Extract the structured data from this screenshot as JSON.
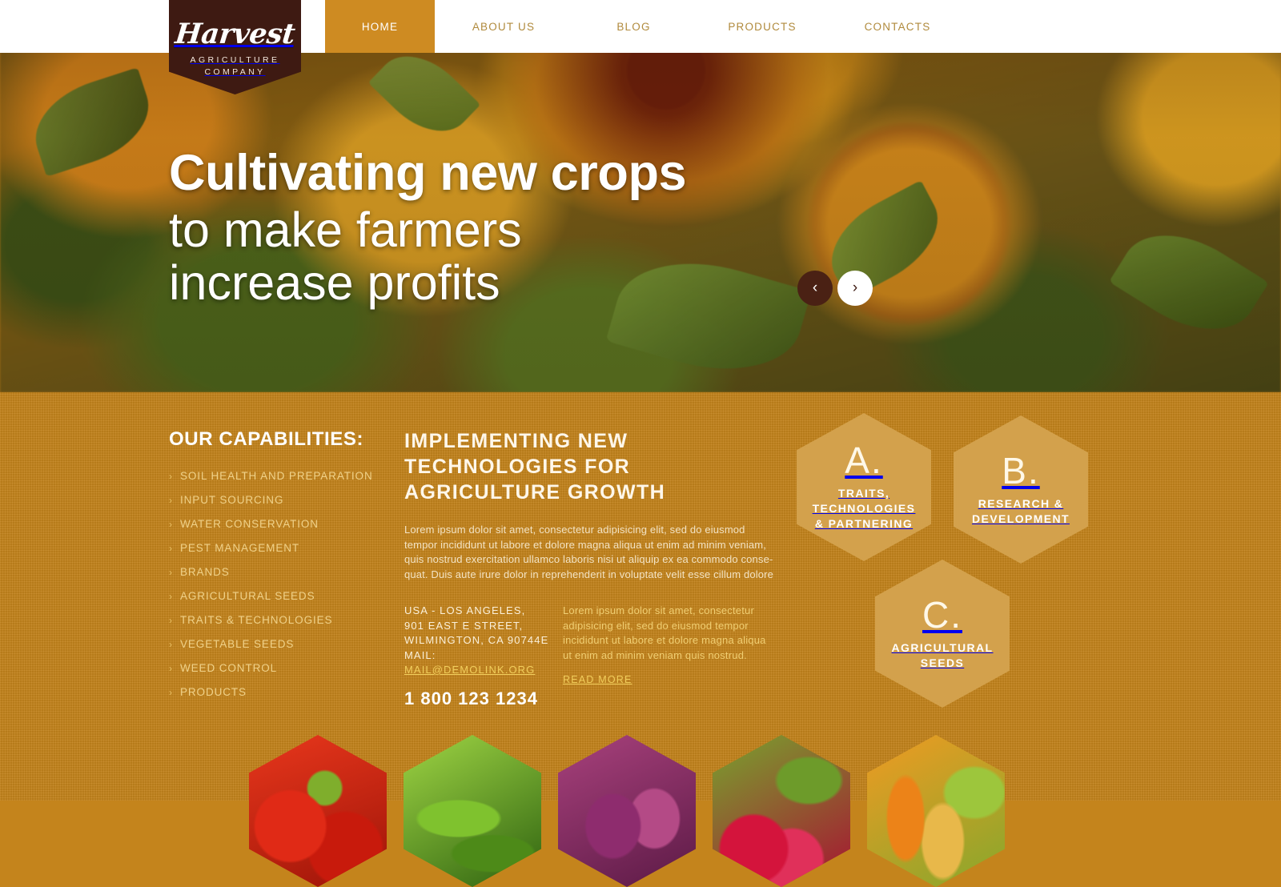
{
  "logo": {
    "word": "Harvest",
    "sub1": "AGRICULTURE",
    "sub2": "COMPANY"
  },
  "nav": {
    "items": [
      {
        "label": "HOME",
        "active": true
      },
      {
        "label": "ABOUT US",
        "active": false
      },
      {
        "label": "BLOG",
        "active": false
      },
      {
        "label": "PRODUCTS",
        "active": false
      },
      {
        "label": "CONTACTS",
        "active": false
      }
    ]
  },
  "hero": {
    "line1": "Cultivating new crops",
    "line2": "to make farmers",
    "line3": "increase profits",
    "prev_icon": "‹",
    "next_icon": "›"
  },
  "capabilities": {
    "title": "OUR CAPABILITIES:",
    "marker": "›",
    "items": [
      "SOIL HEALTH AND PREPARATION",
      "INPUT SOURCING",
      "WATER CONSERVATION",
      "PEST MANAGEMENT",
      "BRANDS",
      "AGRICULTURAL SEEDS",
      "TRAITS & TECHNOLOGIES",
      "VEGETABLE SEEDS",
      "WEED CONTROL",
      "PRODUCTS"
    ]
  },
  "article": {
    "title": "IMPLEMENTING NEW TECHNOLOGIES FOR AGRICULTURE GROWTH",
    "body": "Lorem ipsum dolor sit amet, consectetur adipisicing elit, sed do eiusmod tempor incididunt ut labore et dolore magna aliqua ut enim ad minim veniam, quis nostrud exercitation ullamco laboris nisi ut aliquip ex ea commodo conse-quat. Duis aute irure dolor in reprehenderit in voluptate velit esse cillum dolore",
    "address": {
      "line1": "USA - LOS ANGELES,",
      "line2": "901 EAST E STREET,",
      "line3": "WILMINGTON, CA 90744E",
      "line4": "MAIL:",
      "mail": "MAIL@DEMOLINK.ORG",
      "phone": "1 800 123 1234"
    },
    "side": {
      "body": "Lorem ipsum dolor sit amet, consectetur adipisicing elit, sed do eiusmod tempor incididunt ut labore et dolore magna aliqua ut enim ad minim veniam quis nostrud.",
      "read_more": "READ MORE"
    }
  },
  "features": [
    {
      "letter": "A.",
      "caption": "TRAITS, TECHNOLOGIES & PARTNERING"
    },
    {
      "letter": "B.",
      "caption": "RESEARCH & DEVELOPMENT"
    },
    {
      "letter": "C.",
      "caption": "AGRICULTURAL SEEDS"
    }
  ],
  "produce": [
    {
      "name": "tomatoes"
    },
    {
      "name": "cucumbers"
    },
    {
      "name": "red-onions"
    },
    {
      "name": "radishes"
    },
    {
      "name": "carrots"
    }
  ],
  "colors": {
    "brand_dark": "#3E1A12",
    "accent_gold": "#CE8B22",
    "section_bg": "#C4841C",
    "hex_fill": "#D3A14C",
    "link_gold": "#F2CE5C"
  }
}
